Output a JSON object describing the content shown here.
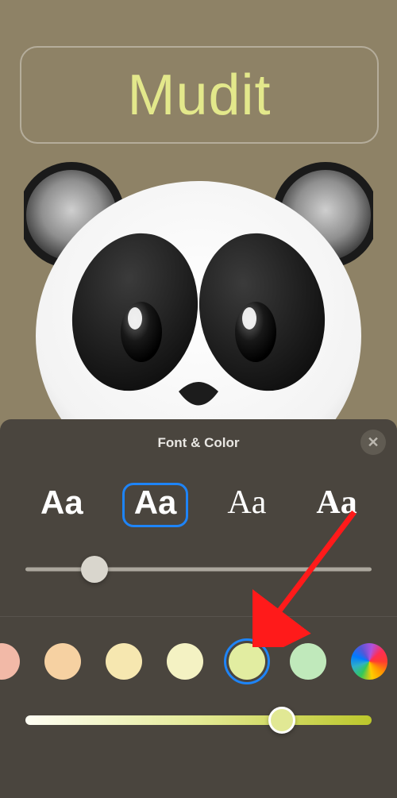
{
  "contact": {
    "name": "Mudit"
  },
  "panel": {
    "title": "Font & Color"
  },
  "fonts": [
    {
      "sample": "Aa"
    },
    {
      "sample": "Aa"
    },
    {
      "sample": "Aa"
    },
    {
      "sample": "Aa"
    }
  ],
  "fontSelectedIndex": 1,
  "sizeSlider": {
    "valuePercent": 20
  },
  "swatches": [
    {
      "color": "#f2b9a7"
    },
    {
      "color": "#f6d1a2"
    },
    {
      "color": "#f6e7b0"
    },
    {
      "color": "#f4f2c3"
    },
    {
      "color": "#e2eda1"
    },
    {
      "color": "#c0e9bb"
    }
  ],
  "selectedSwatchIndex": 4,
  "colorSlider": {
    "valuePercent": 74
  }
}
